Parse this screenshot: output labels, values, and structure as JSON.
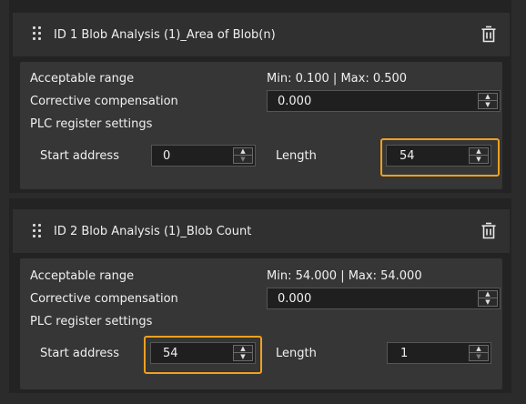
{
  "rules": [
    {
      "title": "ID 1  Blob Analysis (1)_Area of Blob(n)",
      "acceptable_range_label": "Acceptable range",
      "range_text": "Min: 0.100 | Max: 0.500",
      "corrective_label": "Corrective compensation",
      "corrective_value": "0.000",
      "plc_label": "PLC register settings",
      "start_address_label": "Start address",
      "start_address_value": "0",
      "length_label": "Length",
      "length_value": "54"
    },
    {
      "title": "ID 2  Blob Analysis (1)_Blob Count",
      "acceptable_range_label": "Acceptable range",
      "range_text": "Min: 54.000 | Max: 54.000",
      "corrective_label": "Corrective compensation",
      "corrective_value": "0.000",
      "plc_label": "PLC register settings",
      "start_address_label": "Start address",
      "start_address_value": "54",
      "length_label": "Length",
      "length_value": "1"
    }
  ],
  "icons": {
    "drag": "drag-handle-icon",
    "delete": "trash-icon",
    "spin_up": "chevron-up-icon",
    "spin_down": "chevron-down-icon"
  },
  "colors": {
    "focus_outline": "#f0a020"
  }
}
